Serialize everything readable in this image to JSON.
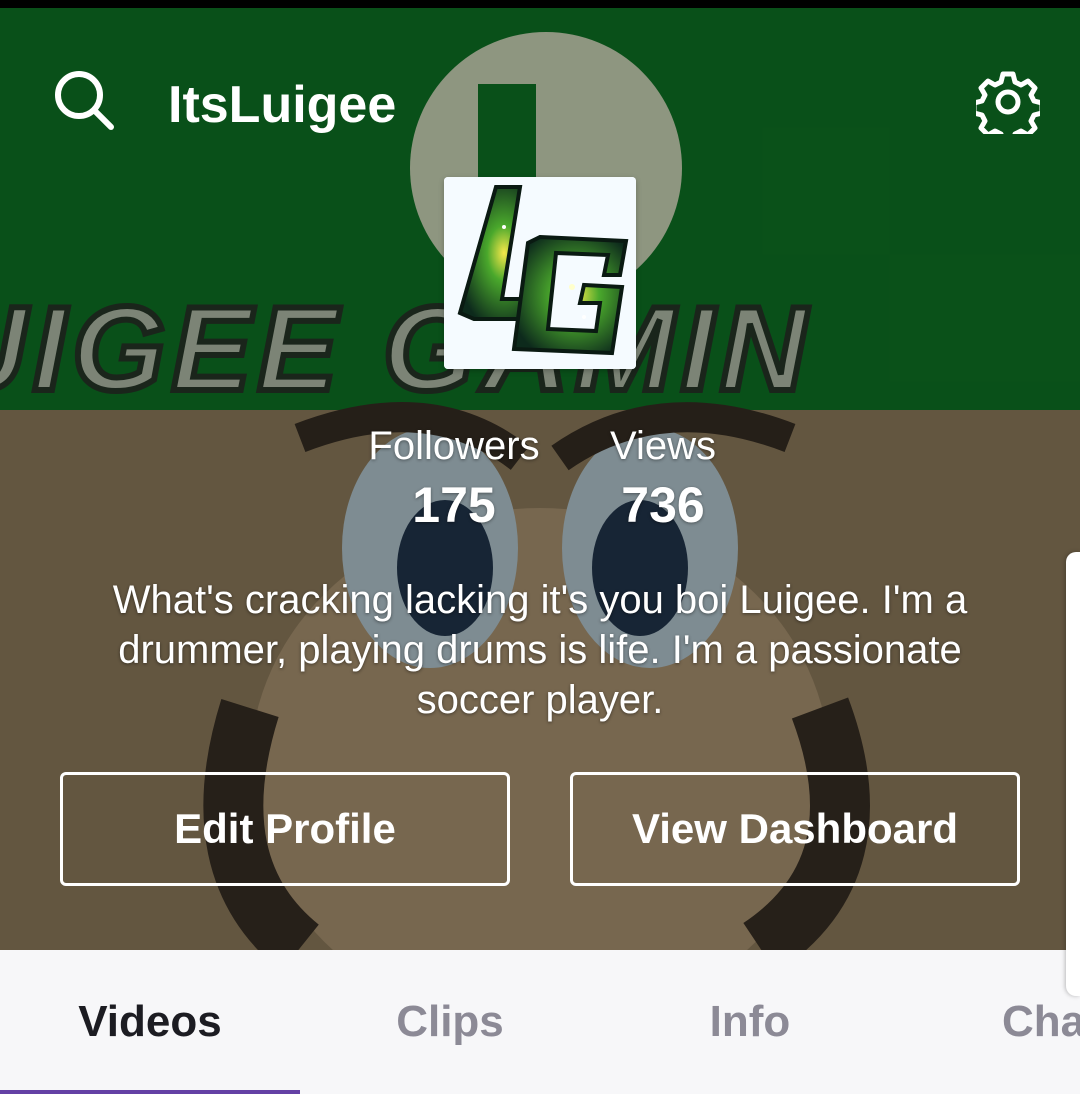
{
  "header": {
    "channel_name": "ItsLuigee",
    "search_icon": "search-icon",
    "settings_icon": "gear-icon"
  },
  "banner": {
    "text": "UIGEE GAMIN"
  },
  "avatar": {
    "logo_text": "LG"
  },
  "stats": {
    "followers_label": "Followers",
    "followers_value": "175",
    "views_label": "Views",
    "views_value": "736"
  },
  "bio": "What's cracking lacking it's you boi Luigee. I'm a drummer, playing drums is life. I'm a passionate soccer player.",
  "actions": {
    "edit_profile": "Edit Profile",
    "view_dashboard": "View Dashboard"
  },
  "tabs": [
    {
      "label": "Videos",
      "active": true
    },
    {
      "label": "Clips",
      "active": false
    },
    {
      "label": "Info",
      "active": false
    },
    {
      "label": "Cha",
      "active": false
    }
  ],
  "colors": {
    "banner_green": "#0b5a1c",
    "banner_tan": "#7d6b4f",
    "accent_purple": "#6441a5",
    "active_tab_text": "#1c1c22",
    "inactive_tab_text": "#8c8a96"
  }
}
